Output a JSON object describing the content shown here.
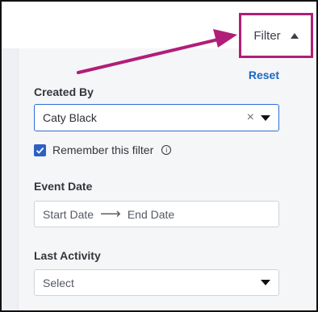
{
  "header": {
    "filter_label": "Filter",
    "reset_label": "Reset"
  },
  "created_by": {
    "label": "Created By",
    "value": "Caty Black",
    "clear_glyph": "×"
  },
  "remember": {
    "label": "Remember this filter",
    "checked": true,
    "info_glyph": "i"
  },
  "event_date": {
    "label": "Event Date",
    "start_placeholder": "Start Date",
    "arrow_glyph": "⟶",
    "end_placeholder": "End Date"
  },
  "last_activity": {
    "label": "Last Activity",
    "value": "Select"
  },
  "colors": {
    "highlight": "#b01e78",
    "link": "#1a66c4",
    "checkbox": "#2d5fc4"
  }
}
